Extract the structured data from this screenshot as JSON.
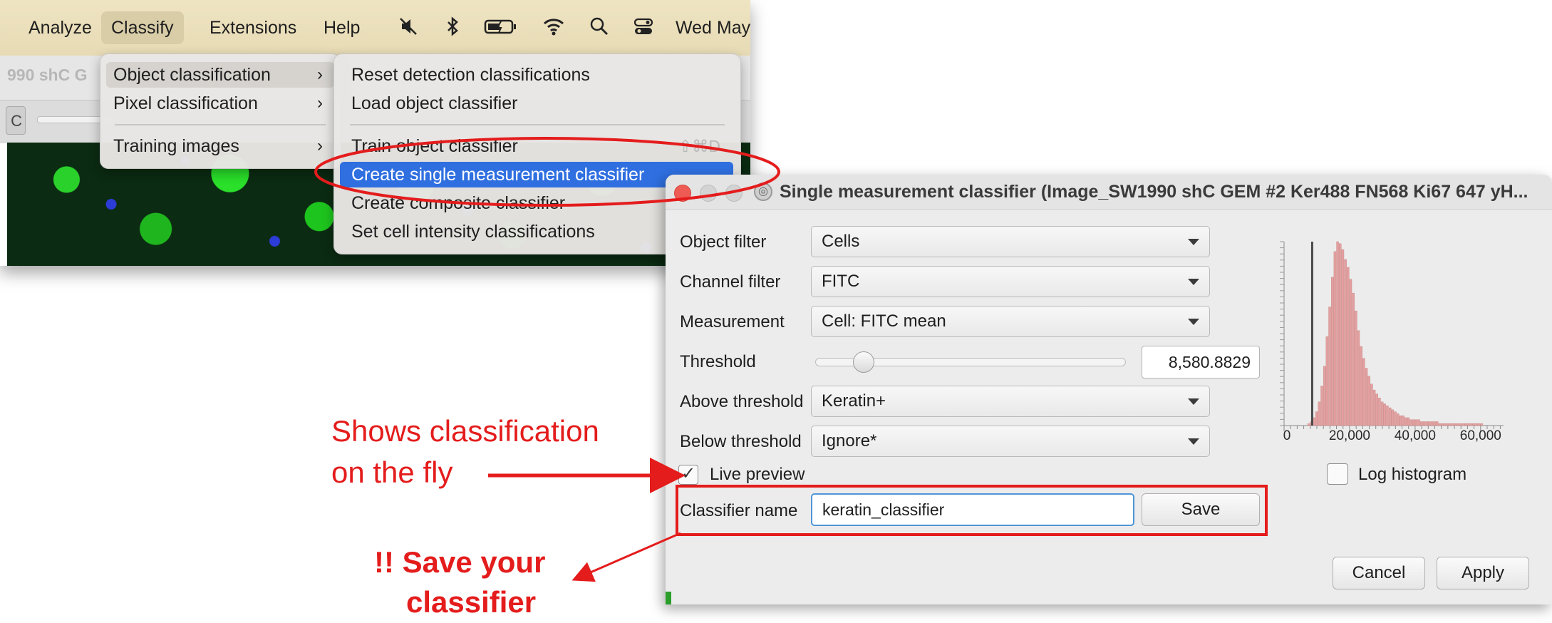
{
  "menubar": {
    "items": [
      "Analyze",
      "Classify",
      "Extensions",
      "Help"
    ],
    "date": "Wed May",
    "icons": [
      "mute-icon",
      "bluetooth-icon",
      "battery-icon",
      "wifi-icon",
      "search-icon",
      "control-center-icon"
    ]
  },
  "app": {
    "title_fragment": "990 shC G",
    "toolbar_button": "C"
  },
  "classify_menu": {
    "items": [
      "Object classification",
      "Pixel classification",
      "Training images"
    ]
  },
  "object_classification_submenu": {
    "items": [
      "Reset detection classifications",
      "Load object classifier",
      "Train object classifier",
      "Create single measurement classifier",
      "Create composite classifier",
      "Set cell intensity classifications"
    ],
    "shortcut": "⇧⌘D"
  },
  "dialog": {
    "title": "Single measurement classifier (Image_SW1990 shC GEM #2 Ker488 FN568 Ki67 647 yH...",
    "object_filter": {
      "label": "Object filter",
      "value": "Cells"
    },
    "channel_filter": {
      "label": "Channel filter",
      "value": "FITC"
    },
    "measurement": {
      "label": "Measurement",
      "value": "Cell: FITC mean"
    },
    "threshold": {
      "label": "Threshold",
      "value": "8,580.8829",
      "slider_fraction": 0.13
    },
    "above_threshold": {
      "label": "Above threshold",
      "value": "Keratin+"
    },
    "below_threshold": {
      "label": "Below threshold",
      "value": "Ignore*"
    },
    "live_preview": {
      "label": "Live preview",
      "checked": true,
      "check_mark": "✓"
    },
    "classifier_name": {
      "label": "Classifier name",
      "value": "keratin_classifier"
    },
    "save_button": "Save",
    "log_histogram": {
      "label": "Log histogram",
      "checked": false
    },
    "cancel_button": "Cancel",
    "apply_button": "Apply"
  },
  "chart_data": {
    "type": "bar",
    "title": "",
    "xlabel": "",
    "ylabel": "",
    "xlim": [
      0,
      67000
    ],
    "xticks": [
      "0",
      "20,000",
      "40,000",
      "60,000"
    ],
    "xtick_values": [
      0,
      20000,
      40000,
      60000
    ],
    "bin_width": 800,
    "bin_start": 0,
    "counts": [
      0,
      0,
      0,
      0,
      0,
      0,
      0,
      0,
      0,
      1,
      2,
      4,
      7,
      12,
      20,
      30,
      45,
      60,
      75,
      88,
      93,
      92,
      89,
      84,
      80,
      74,
      67,
      58,
      48,
      40,
      34,
      29,
      25,
      21,
      18,
      16,
      14,
      12,
      11,
      10,
      9,
      8,
      7,
      6,
      5,
      5,
      4,
      4,
      3,
      3,
      3,
      3,
      2,
      2,
      2,
      2,
      2,
      2,
      2,
      1,
      1,
      1,
      1,
      1,
      1,
      1,
      1,
      1,
      1,
      1,
      1,
      1,
      1,
      1,
      1,
      1,
      0,
      0,
      0,
      0,
      0,
      0,
      0,
      0
    ],
    "threshold": 8580.8829,
    "bar_color": "#e3a0a0",
    "threshold_color": "#4a4a4a"
  },
  "annotations": {
    "live_note_line1": "Shows classification",
    "live_note_line2": "on the fly",
    "save_note_line1": "!! Save your",
    "save_note_line2": "classifier",
    "color": "#e41c1c"
  }
}
